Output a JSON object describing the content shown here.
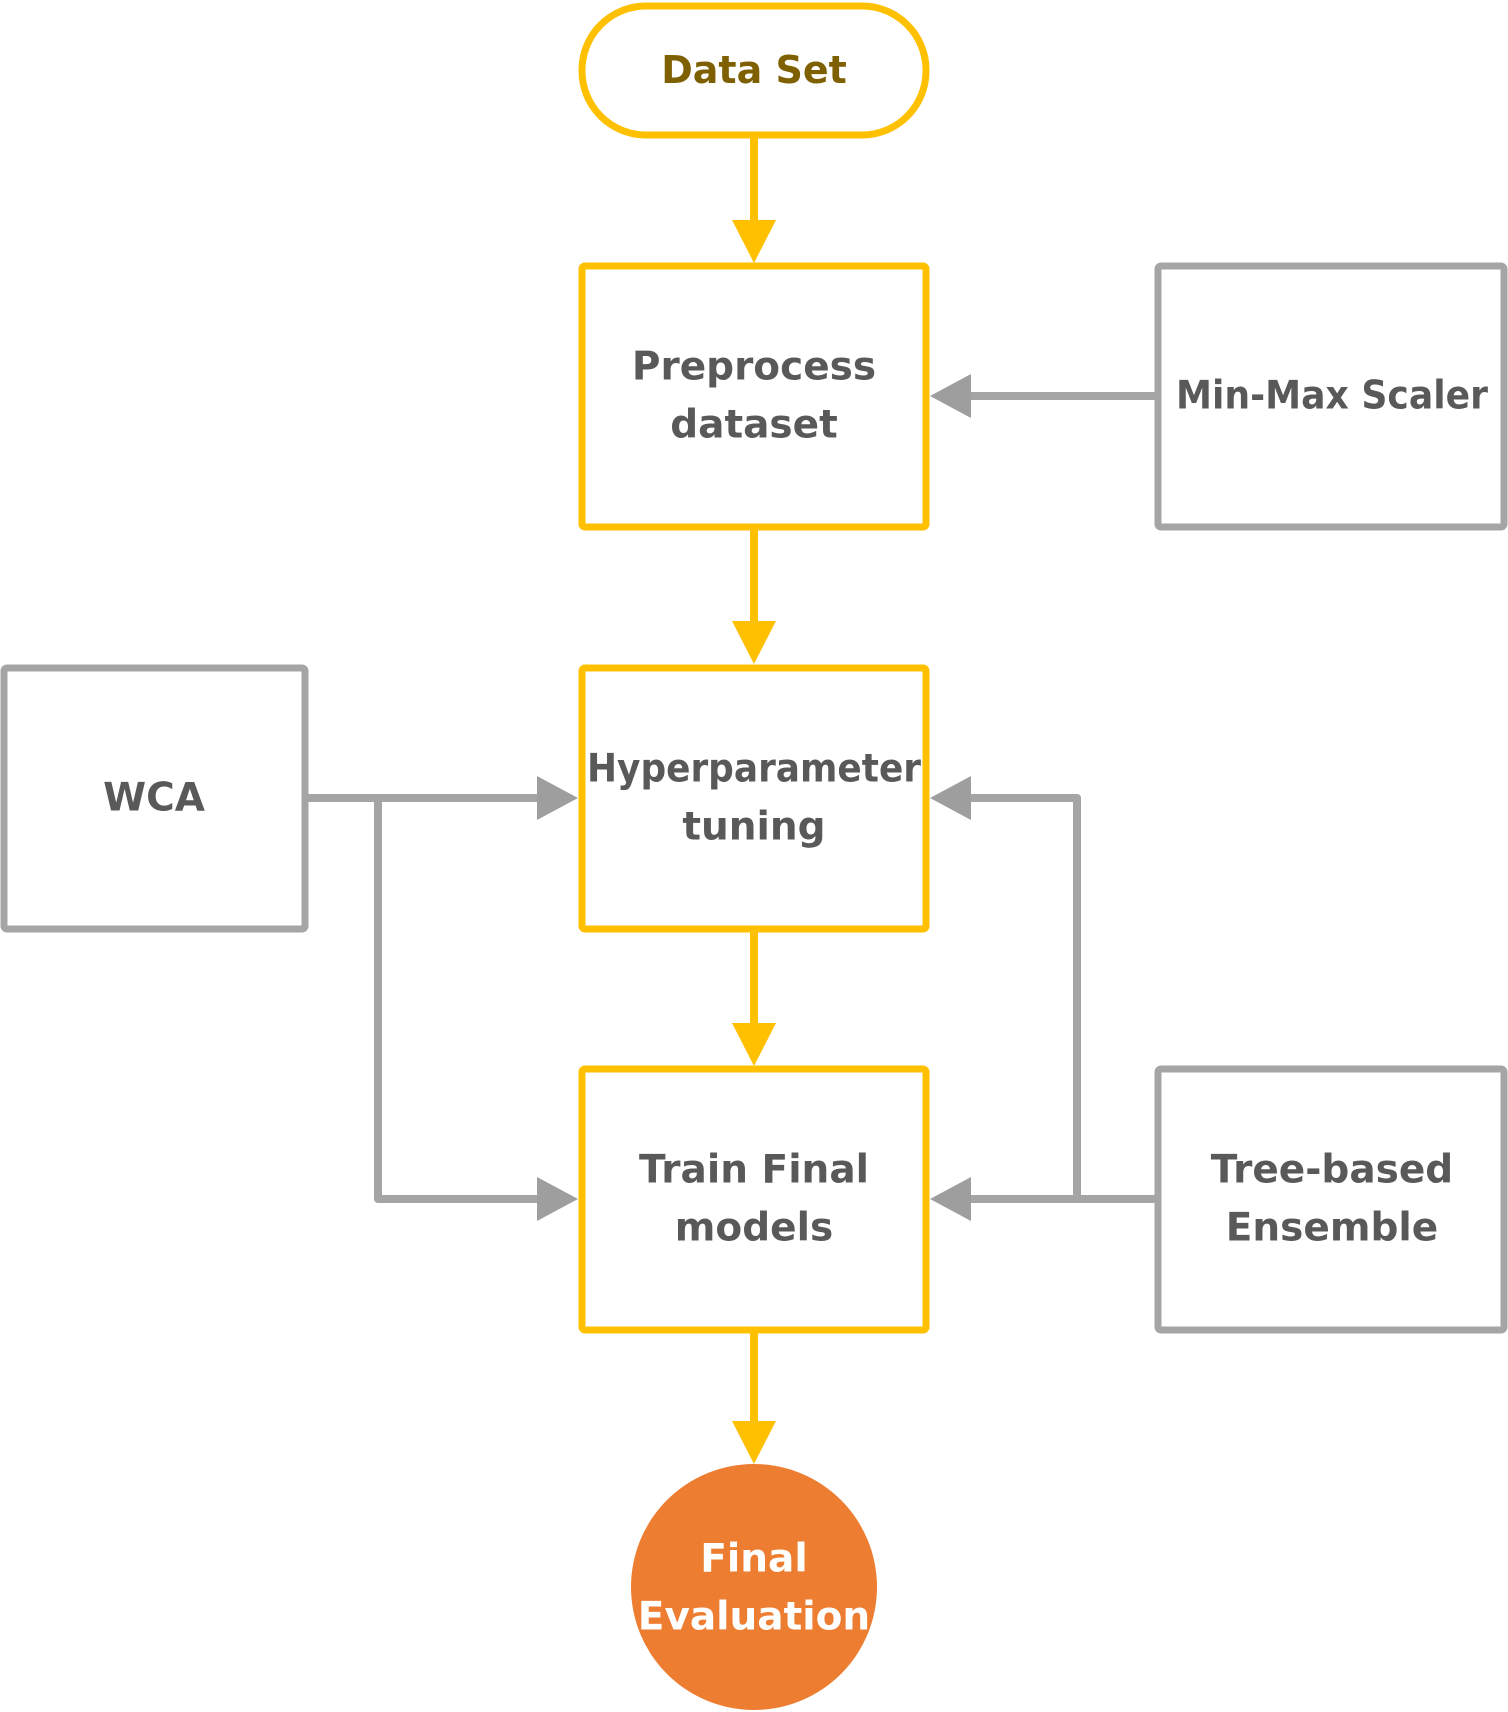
{
  "colors": {
    "main_flow": "#ffc000",
    "side_flow": "#a5a5a5",
    "side_arrow": "#9e9e9e",
    "node_text": "#595959",
    "start_text": "#7f6000",
    "end_fill": "#ed7d31",
    "end_text": "#ffffff"
  },
  "nodes": {
    "data_set": {
      "lines": [
        "Data Set"
      ]
    },
    "preprocess": {
      "lines": [
        "Preprocess",
        "dataset"
      ]
    },
    "hyperparameter": {
      "lines": [
        "Hyperparameter",
        "tuning"
      ]
    },
    "train_final": {
      "lines": [
        "Train Final",
        "models"
      ]
    },
    "final_evaluation": {
      "lines": [
        "Final",
        "Evaluation"
      ]
    },
    "min_max_scaler": {
      "lines": [
        "Min-Max Scaler"
      ]
    },
    "wca": {
      "lines": [
        "WCA"
      ]
    },
    "tree_based": {
      "lines": [
        "Tree-based",
        "Ensemble"
      ]
    }
  },
  "edges": [
    {
      "from": "Data Set",
      "to": "Preprocess dataset"
    },
    {
      "from": "Preprocess dataset",
      "to": "Hyperparameter tuning"
    },
    {
      "from": "Hyperparameter tuning",
      "to": "Train Final models"
    },
    {
      "from": "Train Final models",
      "to": "Final Evaluation"
    },
    {
      "from": "Min-Max Scaler",
      "to": "Preprocess dataset"
    },
    {
      "from": "WCA",
      "to": "Hyperparameter tuning"
    },
    {
      "from": "WCA",
      "to": "Train Final models"
    },
    {
      "from": "Tree-based Ensemble",
      "to": "Hyperparameter tuning"
    },
    {
      "from": "Tree-based Ensemble",
      "to": "Train Final models"
    }
  ]
}
